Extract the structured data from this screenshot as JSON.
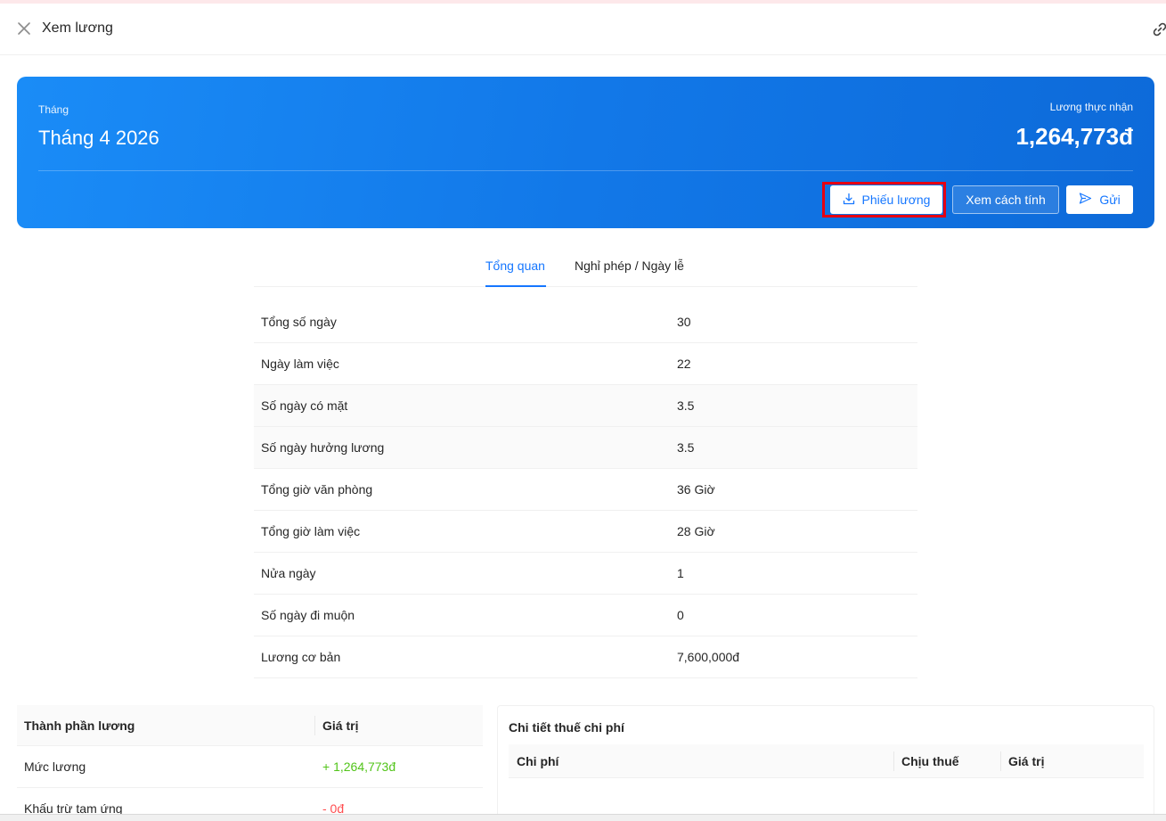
{
  "header": {
    "title": "Xem lương",
    "close_icon": "close-icon",
    "link_icon": "link-icon"
  },
  "banner": {
    "month_label": "Tháng",
    "month_value": "Tháng 4 2026",
    "net_label": "Lương thực nhận",
    "net_value": "1,264,773đ",
    "buttons": {
      "payslip": "Phiếu lương",
      "calc": "Xem cách tính",
      "send": "Gửi"
    },
    "colors": {
      "gradient_start": "#1a8cf7",
      "gradient_end": "#0d6ad9",
      "highlight": "#e60012"
    }
  },
  "tabs": [
    {
      "label": "Tổng quan",
      "active": true
    },
    {
      "label": "Nghỉ phép / Ngày lễ",
      "active": false
    }
  ],
  "stats": [
    {
      "label": "Tổng số ngày",
      "value": "30"
    },
    {
      "label": "Ngày làm việc",
      "value": "22"
    },
    {
      "label": "Số ngày có mặt",
      "value": "3.5"
    },
    {
      "label": "Số ngày hưởng lương",
      "value": "3.5"
    },
    {
      "label": "Tổng giờ văn phòng",
      "value": "36 Giờ"
    },
    {
      "label": "Tổng giờ làm việc",
      "value": "28 Giờ"
    },
    {
      "label": "Nửa ngày",
      "value": "1"
    },
    {
      "label": "Số ngày đi muộn",
      "value": "0"
    },
    {
      "label": "Lương cơ bản",
      "value": "7,600,000đ"
    }
  ],
  "components": {
    "headers": {
      "name": "Thành phần lương",
      "value": "Giá trị"
    },
    "rows": [
      {
        "name": "Mức lương",
        "value": "+ 1,264,773đ",
        "sign": "positive"
      },
      {
        "name": "Khấu trừ tạm ứng",
        "value": "- 0đ",
        "sign": "negative"
      }
    ]
  },
  "tax": {
    "title": "Chi tiết thuế chi phí",
    "headers": {
      "cost": "Chi phí",
      "taxable": "Chịu thuế",
      "value": "Giá trị"
    }
  }
}
